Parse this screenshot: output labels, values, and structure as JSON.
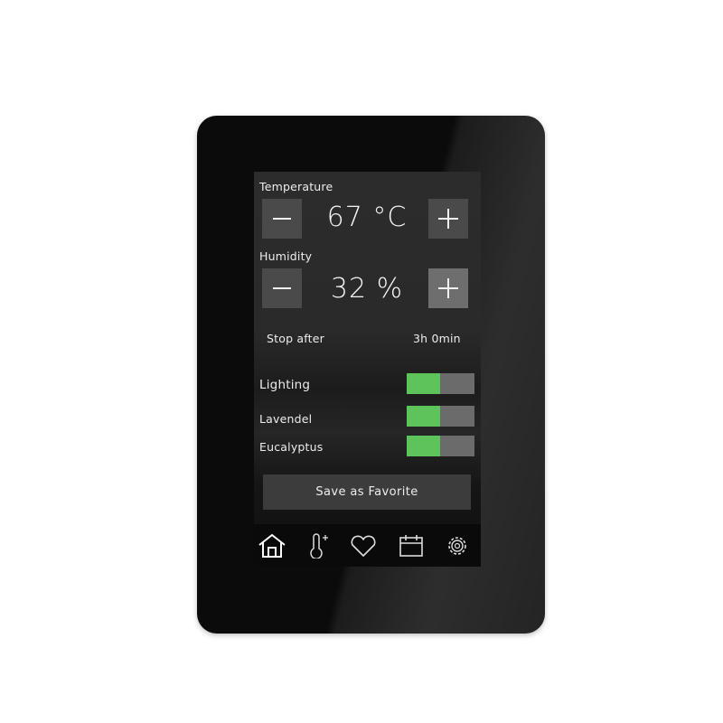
{
  "temperature": {
    "label": "Temperature",
    "value": "67 °C"
  },
  "humidity": {
    "label": "Humidity",
    "value": "32 %"
  },
  "timer": {
    "label": "Stop after",
    "value": "3h 0min"
  },
  "toggles": [
    {
      "label": "Lighting",
      "on": true,
      "color": "#ffffff"
    },
    {
      "label": "Lavendel",
      "on": true,
      "color": "#5fc35b"
    },
    {
      "label": "Eucalyptus",
      "on": true,
      "color": "#ffffff"
    }
  ],
  "save_button": {
    "label": "Save as Favorite"
  },
  "nav": {
    "icons": [
      "home-icon",
      "thermometer-icon",
      "heart-icon",
      "calendar-icon",
      "gear-icon"
    ],
    "active": "home-icon"
  },
  "colors": {
    "accent_green": "#5fc35b",
    "device_body": "#0b0b0b",
    "button": "#4a4a4a"
  }
}
